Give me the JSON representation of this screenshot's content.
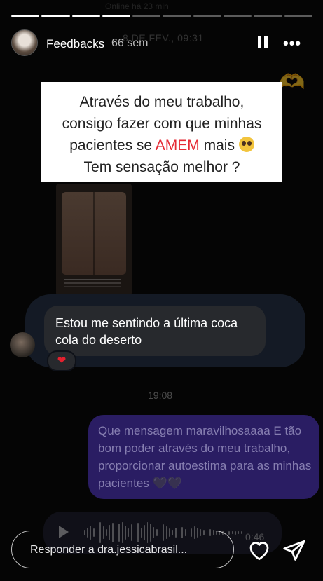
{
  "story": {
    "segments_total": 10,
    "segments_completed": 4,
    "author": "Feedbacks",
    "age": "66 sem"
  },
  "card": {
    "line1": "Através do meu trabalho,",
    "line2": "consigo fazer com que minhas",
    "line3_before": "pacientes se ",
    "line3_highlight": "AMEM",
    "line3_after": " mais",
    "line4": "Tem sensação melhor ?",
    "highlight_color": "#e52b35"
  },
  "chat": {
    "top_faded": "Online há 23 min",
    "date_label": "8 DE FEV., 09:31",
    "incoming_message": "Estou me sentindo a última coca cola do deserto",
    "reaction": "❤",
    "time_label": "19:08",
    "outgoing_message": "Que mensagem maravilhosaaaa E tão bom poder através do meu trabalho, proporcionar autoestima para as minhas pacientes 🖤🖤",
    "voice_duration": "0:46"
  },
  "footer": {
    "reply_placeholder": "Responder a dra.jessicabrasil..."
  },
  "icons": {
    "pause": "pause-icon",
    "more": "more-icon",
    "like": "heart-icon",
    "send": "send-icon"
  }
}
